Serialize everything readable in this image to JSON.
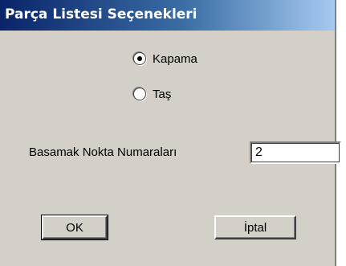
{
  "window": {
    "title": "Parça Listesi Seçenekleri"
  },
  "options": {
    "radio_1": {
      "label": "Kapama",
      "checked": true
    },
    "radio_2": {
      "label": "Taş",
      "checked": false
    }
  },
  "field": {
    "label": "Basamak Nokta Numaraları",
    "value": "2"
  },
  "buttons": {
    "ok": "OK",
    "cancel": "İptal"
  }
}
